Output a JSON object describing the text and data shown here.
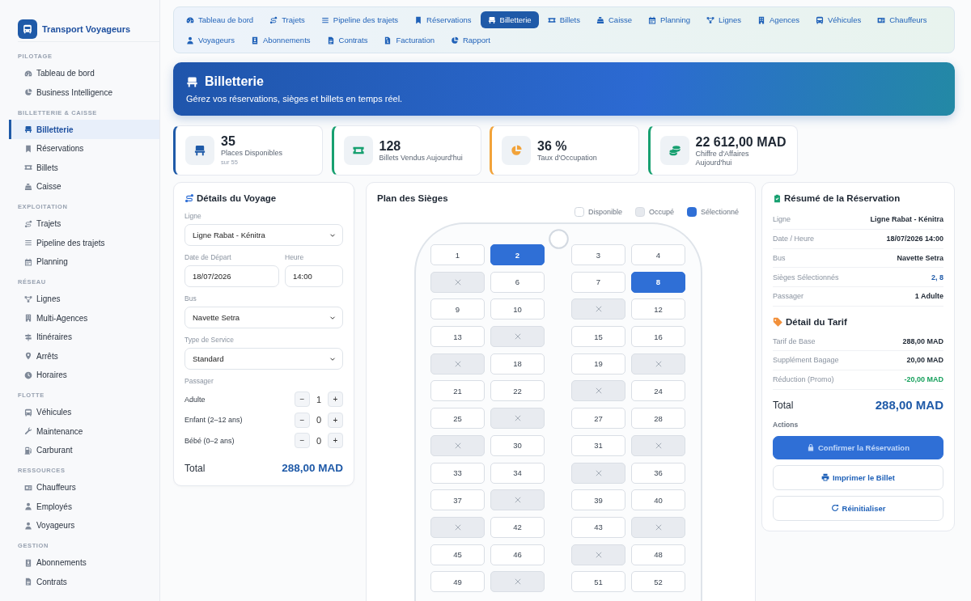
{
  "sidebar": {
    "brand": "Transport Voyageurs",
    "sections": [
      {
        "title": "PILOTAGE",
        "items": [
          {
            "label": "Tableau de bord",
            "selected": false
          },
          {
            "label": "Business Intelligence",
            "selected": false
          }
        ]
      },
      {
        "title": "BILLETTERIE & CAISSE",
        "items": [
          {
            "label": "Billetterie",
            "selected": true
          },
          {
            "label": "Réservations",
            "selected": false
          },
          {
            "label": "Billets",
            "selected": false
          },
          {
            "label": "Caisse",
            "selected": false
          }
        ]
      },
      {
        "title": "EXPLOITATION",
        "items": [
          {
            "label": "Trajets",
            "selected": false
          },
          {
            "label": "Pipeline des trajets",
            "selected": false
          },
          {
            "label": "Planning",
            "selected": false
          }
        ]
      },
      {
        "title": "RÉSEAU",
        "items": [
          {
            "label": "Lignes",
            "selected": false
          },
          {
            "label": "Multi-Agences",
            "selected": false
          },
          {
            "label": "Itinéraires",
            "selected": false
          },
          {
            "label": "Arrêts",
            "selected": false
          },
          {
            "label": "Horaires",
            "selected": false
          }
        ]
      },
      {
        "title": "FLOTTE",
        "items": [
          {
            "label": "Véhicules",
            "selected": false
          },
          {
            "label": "Maintenance",
            "selected": false
          },
          {
            "label": "Carburant",
            "selected": false
          }
        ]
      },
      {
        "title": "RESSOURCES",
        "items": [
          {
            "label": "Chauffeurs",
            "selected": false
          },
          {
            "label": "Employés",
            "selected": false
          },
          {
            "label": "Voyageurs",
            "selected": false
          }
        ]
      },
      {
        "title": "GESTION",
        "items": [
          {
            "label": "Abonnements",
            "selected": false
          },
          {
            "label": "Contrats",
            "selected": false
          }
        ]
      }
    ]
  },
  "nav_tabs": [
    {
      "label": "Tableau de bord",
      "selected": false
    },
    {
      "label": "Trajets",
      "selected": false
    },
    {
      "label": "Pipeline des trajets",
      "selected": false
    },
    {
      "label": "Réservations",
      "selected": false
    },
    {
      "label": "Billetterie",
      "selected": true
    },
    {
      "label": "Billets",
      "selected": false
    },
    {
      "label": "Caisse",
      "selected": false
    },
    {
      "label": "Planning",
      "selected": false
    },
    {
      "label": "Lignes",
      "selected": false
    },
    {
      "label": "Agences",
      "selected": false
    },
    {
      "label": "Véhicules",
      "selected": false
    },
    {
      "label": "Chauffeurs",
      "selected": false
    },
    {
      "label": "Voyageurs",
      "selected": false
    },
    {
      "label": "Abonnements",
      "selected": false
    },
    {
      "label": "Contrats",
      "selected": false
    },
    {
      "label": "Facturation",
      "selected": false
    },
    {
      "label": "Rapport",
      "selected": false
    }
  ],
  "banner": {
    "title": "Billetterie",
    "subtitle": "Gérez vos réservations, sièges et billets en temps réel."
  },
  "stats": [
    {
      "value": "35",
      "label": "Places Disponibles",
      "note": "sur 55",
      "color": "#1f5aa8"
    },
    {
      "value": "128",
      "label": "Billets Vendus Aujourd'hui",
      "color": "#17a070"
    },
    {
      "value": "36 %",
      "label": "Taux d'Occupation",
      "color": "#f2a33a"
    },
    {
      "value": "22 612,00 MAD",
      "label": "Chiffre d'Affaires Aujourd'hui",
      "color": "#17a070"
    }
  ],
  "trip_details": {
    "title": "Détails du Voyage",
    "line": {
      "label": "Ligne",
      "value": "Ligne Rabat - Kénitra"
    },
    "date": {
      "label": "Date de Départ",
      "value": "18/07/2026"
    },
    "time": {
      "label": "Heure",
      "value": "14:00"
    },
    "bus": {
      "label": "Bus",
      "value": "Navette Setra"
    },
    "service": {
      "label": "Type de Service",
      "value": "Standard"
    },
    "passengers": {
      "label": "Passager",
      "rows": [
        {
          "label": "Adulte",
          "count": "1",
          "decrement": "−",
          "increment": "+"
        },
        {
          "label": "Enfant (2–12 ans)",
          "count": "0",
          "decrement": "−",
          "increment": "+"
        },
        {
          "label": "Bébé (0–2 ans)",
          "count": "0",
          "decrement": "−",
          "increment": "+"
        }
      ]
    },
    "total": {
      "label": "Total",
      "value": "288,00 MAD"
    }
  },
  "seat_map": {
    "title": "Plan des Sièges",
    "legend": [
      {
        "label": "Disponible",
        "kind": "available"
      },
      {
        "label": "Occupé",
        "kind": "occupied"
      },
      {
        "label": "Sélectionné",
        "kind": "selected"
      }
    ],
    "seats": [
      {
        "label": "1",
        "selected": false,
        "occupied": false
      },
      {
        "label": "2",
        "selected": true,
        "occupied": false
      },
      {
        "label": "3",
        "selected": false,
        "occupied": false
      },
      {
        "label": "4",
        "selected": false,
        "occupied": false
      },
      {
        "selected": false,
        "occupied": true
      },
      {
        "label": "6",
        "selected": false,
        "occupied": false
      },
      {
        "label": "7",
        "selected": false,
        "occupied": false
      },
      {
        "label": "8",
        "selected": true,
        "occupied": false
      },
      {
        "label": "9",
        "selected": false,
        "occupied": false
      },
      {
        "label": "10",
        "selected": false,
        "occupied": false
      },
      {
        "selected": false,
        "occupied": true
      },
      {
        "label": "12",
        "selected": false,
        "occupied": false
      },
      {
        "label": "13",
        "selected": false,
        "occupied": false
      },
      {
        "selected": false,
        "occupied": true
      },
      {
        "label": "15",
        "selected": false,
        "occupied": false
      },
      {
        "label": "16",
        "selected": false,
        "occupied": false
      },
      {
        "selected": false,
        "occupied": true
      },
      {
        "label": "18",
        "selected": false,
        "occupied": false
      },
      {
        "label": "19",
        "selected": false,
        "occupied": false
      },
      {
        "selected": false,
        "occupied": true
      },
      {
        "label": "21",
        "selected": false,
        "occupied": false
      },
      {
        "label": "22",
        "selected": false,
        "occupied": false
      },
      {
        "selected": false,
        "occupied": true
      },
      {
        "label": "24",
        "selected": false,
        "occupied": false
      },
      {
        "label": "25",
        "selected": false,
        "occupied": false
      },
      {
        "selected": false,
        "occupied": true
      },
      {
        "label": "27",
        "selected": false,
        "occupied": false
      },
      {
        "label": "28",
        "selected": false,
        "occupied": false
      },
      {
        "selected": false,
        "occupied": true
      },
      {
        "label": "30",
        "selected": false,
        "occupied": false
      },
      {
        "label": "31",
        "selected": false,
        "occupied": false
      },
      {
        "selected": false,
        "occupied": true
      },
      {
        "label": "33",
        "selected": false,
        "occupied": false
      },
      {
        "label": "34",
        "selected": false,
        "occupied": false
      },
      {
        "selected": false,
        "occupied": true
      },
      {
        "label": "36",
        "selected": false,
        "occupied": false
      },
      {
        "label": "37",
        "selected": false,
        "occupied": false
      },
      {
        "selected": false,
        "occupied": true
      },
      {
        "label": "39",
        "selected": false,
        "occupied": false
      },
      {
        "label": "40",
        "selected": false,
        "occupied": false
      },
      {
        "selected": false,
        "occupied": true
      },
      {
        "label": "42",
        "selected": false,
        "occupied": false
      },
      {
        "label": "43",
        "selected": false,
        "occupied": false
      },
      {
        "selected": false,
        "occupied": true
      },
      {
        "label": "45",
        "selected": false,
        "occupied": false
      },
      {
        "label": "46",
        "selected": false,
        "occupied": false
      },
      {
        "selected": false,
        "occupied": true
      },
      {
        "label": "48",
        "selected": false,
        "occupied": false
      },
      {
        "label": "49",
        "selected": false,
        "occupied": false
      },
      {
        "selected": false,
        "occupied": true
      },
      {
        "label": "51",
        "selected": false,
        "occupied": false
      },
      {
        "label": "52",
        "selected": false,
        "occupied": false
      }
    ]
  },
  "summary": {
    "title": "Résumé de la Réservation",
    "rows": [
      {
        "label": "Ligne",
        "value": "Ligne Rabat - Kénitra",
        "kind": "plain"
      },
      {
        "label": "Date / Heure",
        "value": "18/07/2026 14:00",
        "kind": "plain"
      },
      {
        "label": "Bus",
        "value": "Navette Setra",
        "kind": "plain"
      },
      {
        "label": "Sièges Sélectionnés",
        "value": "2, 8",
        "kind": "highlight"
      },
      {
        "label": "Passager",
        "value": "1 Adulte",
        "kind": "plain"
      }
    ],
    "fare": {
      "title": "Détail du Tarif",
      "rows": [
        {
          "label": "Tarif de Base",
          "value": "288,00 MAD",
          "kind": "plain"
        },
        {
          "label": "Supplément Bagage",
          "value": "20,00 MAD",
          "kind": "plain"
        },
        {
          "label": "Réduction (Promo)",
          "value": "-20,00 MAD",
          "kind": "discount"
        }
      ]
    },
    "total": {
      "label": "Total",
      "value": "288,00 MAD"
    },
    "actions": {
      "label": "Actions",
      "buttons": [
        {
          "label": "Confirmer la Réservation",
          "kind": "primary"
        },
        {
          "label": "Imprimer le Billet",
          "kind": "secondary"
        },
        {
          "label": "Réinitialiser",
          "kind": "secondary"
        }
      ]
    }
  }
}
